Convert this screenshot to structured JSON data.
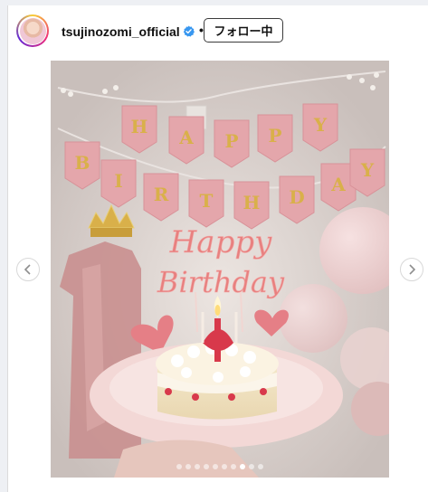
{
  "post": {
    "username": "tsujinozomi_official",
    "verified_icon": "verified-badge-icon",
    "separator": "•",
    "follow_label": "フォロー中"
  },
  "media": {
    "banner_letters": [
      "H",
      "A",
      "P",
      "P",
      "Y",
      "B",
      "I",
      "R",
      "T",
      "H",
      "D",
      "A",
      "Y"
    ],
    "topper_line1": "Happy",
    "topper_line2": "Birthday",
    "carousel_total": 10,
    "carousel_active_index": 7,
    "prev_icon": "chevron-left-icon",
    "next_icon": "chevron-right-icon"
  },
  "colors": {
    "verified": "#3897f0",
    "banner_flag": "#e4a6ab",
    "banner_letter": "#d9b04a",
    "topper": "#e8807f",
    "plate": "#f3d8d6"
  }
}
